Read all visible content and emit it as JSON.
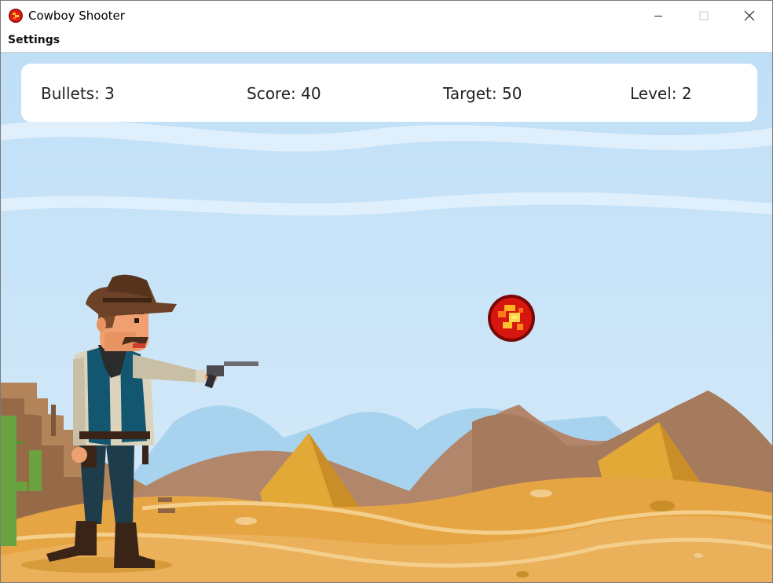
{
  "window": {
    "title": "Cowboy Shooter",
    "icon": "fireball-icon",
    "controls": [
      "minimize",
      "maximize",
      "close"
    ]
  },
  "menu": {
    "items": [
      {
        "label": "Settings"
      }
    ]
  },
  "hud": {
    "bullets": "Bullets: 3",
    "score": "Score: 40",
    "target": "Target: 50",
    "level": "Level: 2"
  },
  "scene": {
    "player": "cowboy-with-revolver",
    "projectile": "fireball",
    "background": "desert-with-pyramids",
    "colors": {
      "sky": "#c3e2f8",
      "sand": "#e9ad48",
      "dune": "#b2866a",
      "pyramid": "#dca43a"
    }
  }
}
